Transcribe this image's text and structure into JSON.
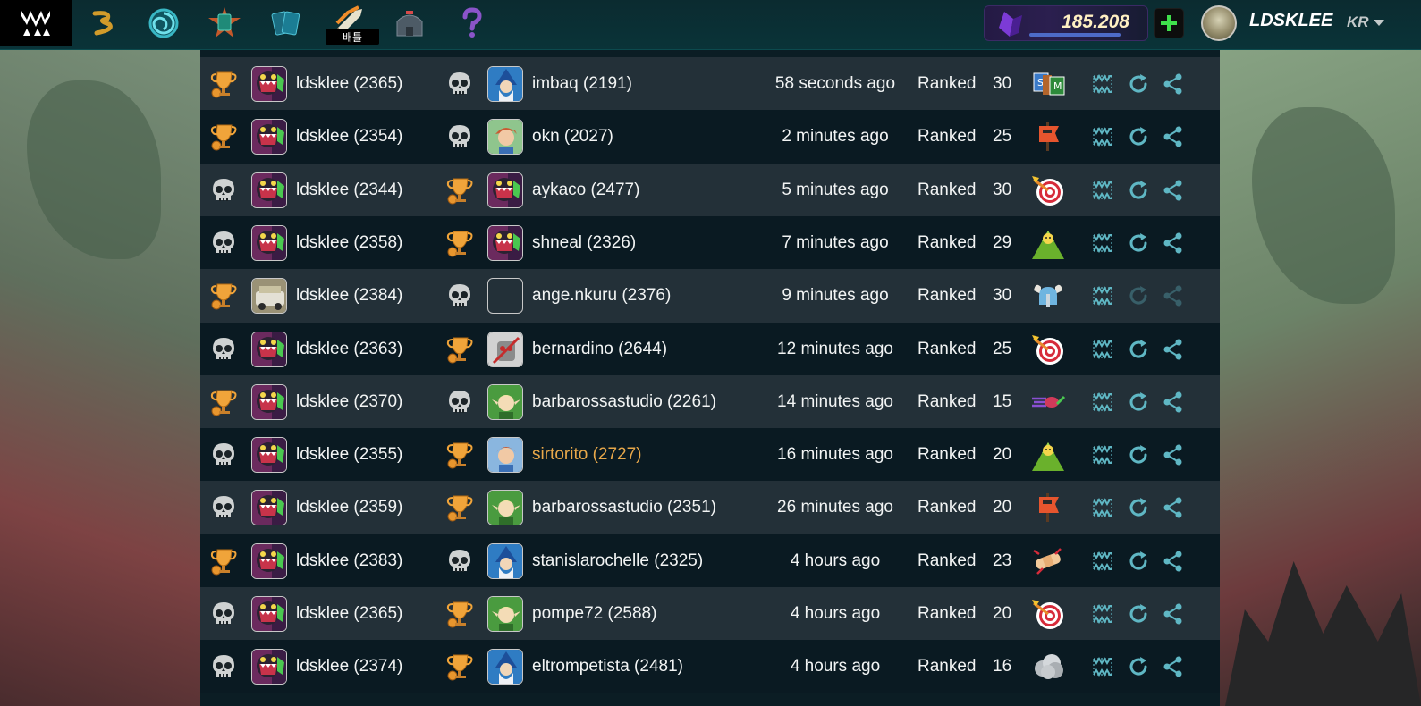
{
  "topbar": {
    "nav_battle_label": "배틀",
    "dec_balance": "185.208",
    "username": "LDSKLEE",
    "language": "KR"
  },
  "colors": {
    "accent_teal": "#5fb7c4",
    "highlight_name": "#e8a84a",
    "trophy_gold": "#f0a43a"
  },
  "battles": [
    {
      "p1_result": "win",
      "p1_name": "ldsklee (2365)",
      "p1_avatar": "monster",
      "p2_result": "loss",
      "p2_name": "imbaq (2191)",
      "p2_avatar": "wizard-blue",
      "time": "58 seconds ago",
      "mode": "Ranked",
      "mana": "30",
      "rule": "cards-icon",
      "actions_disabled": false
    },
    {
      "p1_result": "win",
      "p1_name": "ldsklee (2354)",
      "p1_avatar": "monster",
      "p2_result": "loss",
      "p2_name": "okn (2027)",
      "p2_avatar": "redhair-green",
      "time": "2 minutes ago",
      "mode": "Ranked",
      "mana": "25",
      "rule": "flag-icon",
      "actions_disabled": false
    },
    {
      "p1_result": "loss",
      "p1_name": "ldsklee (2344)",
      "p1_avatar": "monster",
      "p2_result": "win",
      "p2_name": "aykaco (2477)",
      "p2_avatar": "monster",
      "time": "5 minutes ago",
      "mode": "Ranked",
      "mana": "30",
      "rule": "target-icon",
      "actions_disabled": false
    },
    {
      "p1_result": "loss",
      "p1_name": "ldsklee (2358)",
      "p1_avatar": "monster",
      "p2_result": "win",
      "p2_name": "shneal (2326)",
      "p2_avatar": "monster",
      "time": "7 minutes ago",
      "mode": "Ranked",
      "mana": "29",
      "rule": "mountain-icon",
      "actions_disabled": false
    },
    {
      "p1_result": "win",
      "p1_name": "ldsklee (2384)",
      "p1_avatar": "vehicle",
      "p2_result": "loss",
      "p2_name": "ange.nkuru (2376)",
      "p2_avatar": "empty",
      "time": "9 minutes ago",
      "mode": "Ranked",
      "mana": "30",
      "rule": "viking-helmet-icon",
      "actions_disabled": true
    },
    {
      "p1_result": "loss",
      "p1_name": "ldsklee (2363)",
      "p1_avatar": "monster",
      "p2_result": "win",
      "p2_name": "bernardino (2644)",
      "p2_avatar": "robot",
      "time": "12 minutes ago",
      "mode": "Ranked",
      "mana": "25",
      "rule": "target-icon",
      "actions_disabled": false
    },
    {
      "p1_result": "win",
      "p1_name": "ldsklee (2370)",
      "p1_avatar": "monster",
      "p2_result": "loss",
      "p2_name": "barbarossastudio (2261)",
      "p2_avatar": "elf-green",
      "time": "14 minutes ago",
      "mode": "Ranked",
      "mana": "15",
      "rule": "speed-icon",
      "actions_disabled": false
    },
    {
      "p1_result": "loss",
      "p1_name": "ldsklee (2355)",
      "p1_avatar": "monster",
      "p2_result": "win",
      "p2_name": "sirtorito (2727)",
      "p2_avatar": "redhair-blue",
      "time": "16 minutes ago",
      "mode": "Ranked",
      "mana": "20",
      "rule": "mountain-icon",
      "actions_disabled": false,
      "p2_highlight": true
    },
    {
      "p1_result": "loss",
      "p1_name": "ldsklee (2359)",
      "p1_avatar": "monster",
      "p2_result": "win",
      "p2_name": "barbarossastudio (2351)",
      "p2_avatar": "elf-green",
      "time": "26 minutes ago",
      "mode": "Ranked",
      "mana": "20",
      "rule": "flag-icon",
      "actions_disabled": false
    },
    {
      "p1_result": "win",
      "p1_name": "ldsklee (2383)",
      "p1_avatar": "monster",
      "p2_result": "loss",
      "p2_name": "stanislarochelle (2325)",
      "p2_avatar": "wizard-blue",
      "time": "4 hours ago",
      "mode": "Ranked",
      "mana": "23",
      "rule": "bandage-icon",
      "actions_disabled": false
    },
    {
      "p1_result": "loss",
      "p1_name": "ldsklee (2365)",
      "p1_avatar": "monster",
      "p2_result": "win",
      "p2_name": "pompe72 (2588)",
      "p2_avatar": "elf-green",
      "time": "4 hours ago",
      "mode": "Ranked",
      "mana": "20",
      "rule": "target-icon",
      "actions_disabled": false
    },
    {
      "p1_result": "loss",
      "p1_name": "ldsklee (2374)",
      "p1_avatar": "monster",
      "p2_result": "win",
      "p2_name": "eltrompetista (2481)",
      "p2_avatar": "wizard-blue",
      "time": "4 hours ago",
      "mode": "Ranked",
      "mana": "16",
      "rule": "cloud-icon",
      "actions_disabled": false
    }
  ]
}
